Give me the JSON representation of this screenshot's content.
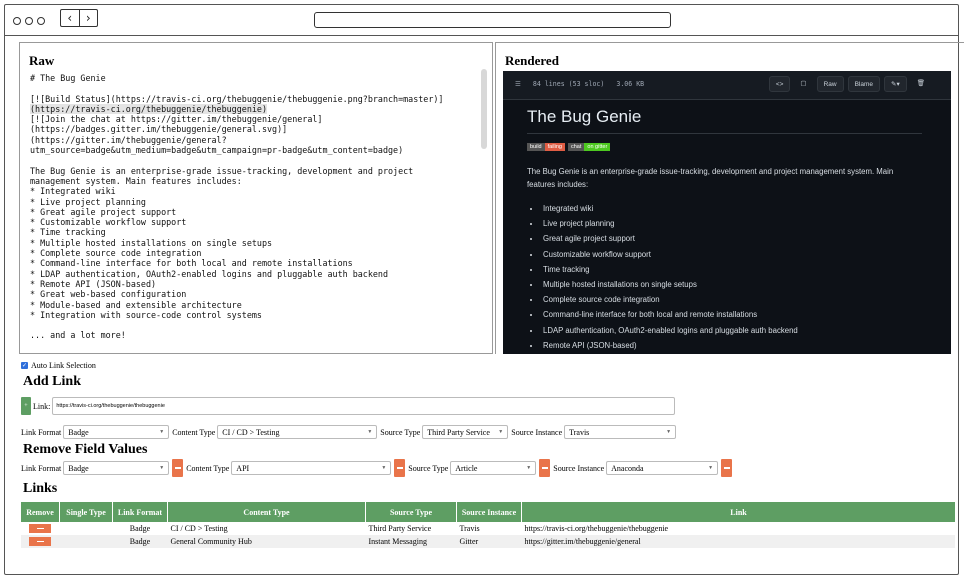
{
  "raw": {
    "heading": "Raw",
    "lines": [
      "# The Bug Genie",
      "",
      "[![Build Status](https://travis-ci.org/thebuggenie/thebuggenie.png?branch=master)]",
      "(https://travis-ci.org/thebuggenie/thebuggenie)",
      "[![Join the chat at https://gitter.im/thebuggenie/general]",
      "(https://badges.gitter.im/thebuggenie/general.svg)]",
      "(https://gitter.im/thebuggenie/general?",
      "utm_source=badge&utm_medium=badge&utm_campaign=pr-badge&utm_content=badge)",
      "",
      "The Bug Genie is an enterprise-grade issue-tracking, development and project",
      "management system. Main features includes:",
      "* Integrated wiki",
      "* Live project planning",
      "* Great agile project support",
      "* Customizable workflow support",
      "* Time tracking",
      "* Multiple hosted installations on single setups",
      "* Complete source code integration",
      "* Command-line interface for both local and remote installations",
      "* LDAP authentication, OAuth2-enabled logins and pluggable auth backend",
      "* Remote API (JSON-based)",
      "* Great web-based configuration",
      "* Module-based and extensible architecture",
      "* Integration with source-code control systems",
      "",
      "... and a lot more!"
    ]
  },
  "rendered": {
    "heading": "Rendered",
    "file_lines": "84 lines (53 sloc)",
    "file_size": "3.06 KB",
    "btn_raw": "Raw",
    "btn_blame": "Blame",
    "title": "The Bug Genie",
    "badge_build_label": "build",
    "badge_build_value": "failing",
    "badge_chat_label": "chat",
    "badge_chat_value": "on gitter",
    "description": "The Bug Genie is an enterprise-grade issue-tracking, development and project management system. Main features includes:",
    "features": [
      "Integrated wiki",
      "Live project planning",
      "Great agile project support",
      "Customizable workflow support",
      "Time tracking",
      "Multiple hosted installations on single setups",
      "Complete source code integration",
      "Command-line interface for both local and remote installations",
      "LDAP authentication, OAuth2-enabled logins and pluggable auth backend",
      "Remote API (JSON-based)"
    ]
  },
  "auto_link_label": "Auto Link Selection",
  "add_link": {
    "heading": "Add Link",
    "link_label": "Link:",
    "link_value": "https://travis-ci.org/thebuggenie/thebuggenie",
    "link_format_label": "Link Format",
    "link_format_value": "Badge",
    "content_type_label": "Content Type",
    "content_type_value": "CI / CD > Testing",
    "source_type_label": "Source Type",
    "source_type_value": "Third Party Service",
    "source_instance_label": "Source Instance",
    "source_instance_value": "Travis"
  },
  "remove_fields": {
    "heading": "Remove Field Values",
    "link_format_label": "Link Format",
    "link_format_value": "Badge",
    "content_type_label": "Content Type",
    "content_type_value": "API",
    "source_type_label": "Source Type",
    "source_type_value": "Article",
    "source_instance_label": "Source Instance",
    "source_instance_value": "Anaconda"
  },
  "links": {
    "heading": "Links",
    "columns": [
      "Remove",
      "Single Type",
      "Link Format",
      "Content Type",
      "Source Type",
      "Source Instance",
      "Link"
    ],
    "rows": [
      {
        "single_type": "",
        "link_format": "Badge",
        "content_type": "CI / CD > Testing",
        "source_type": "Third Party Service",
        "source_instance": "Travis",
        "link": "https://travis-ci.org/thebuggenie/thebuggenie"
      },
      {
        "single_type": "",
        "link_format": "Badge",
        "content_type": "General Community Hub",
        "source_type": "Instant Messaging",
        "source_instance": "Gitter",
        "link": "https://gitter.im/thebuggenie/general"
      }
    ]
  },
  "colors": {
    "accent_green": "#5e9e63",
    "remove_orange": "#e9744a",
    "badge_failing": "#e05d44",
    "badge_gitter": "#4dc820"
  }
}
